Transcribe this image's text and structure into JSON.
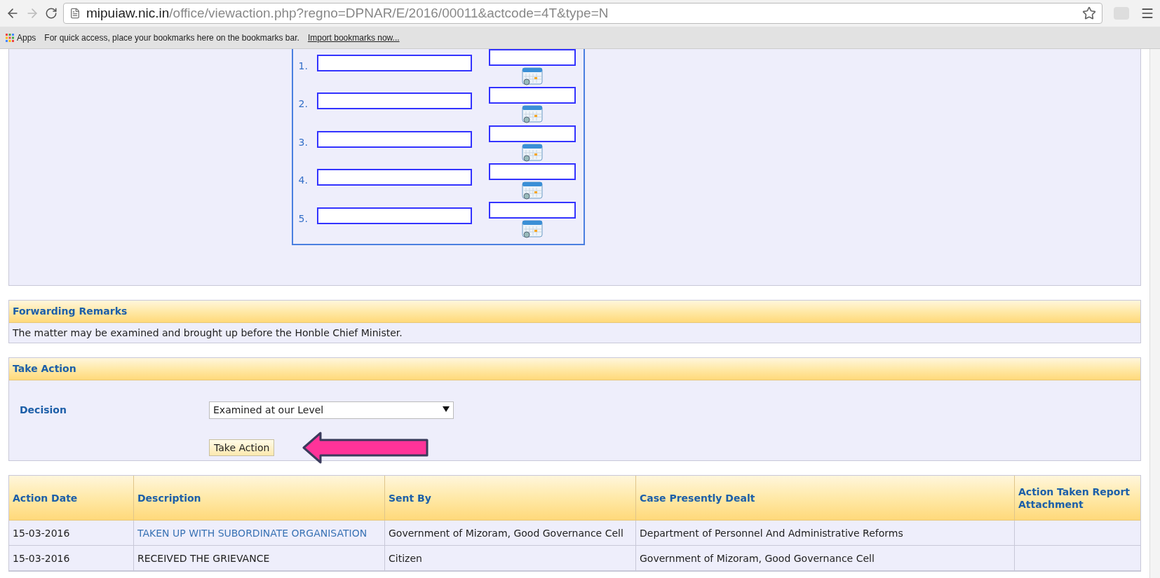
{
  "browser": {
    "url_host": "mipuiaw.nic.in",
    "url_path": "/office/viewaction.php?regno=DPNAR/E/2016/00011&actcode=4T&type=N",
    "bookmarks": {
      "apps": "Apps",
      "hint": "For quick access, place your bookmarks here on the bookmarks bar.",
      "import_link": "Import bookmarks now..."
    }
  },
  "entries": [
    {
      "number": "1."
    },
    {
      "number": "2."
    },
    {
      "number": "3."
    },
    {
      "number": "4."
    },
    {
      "number": "5."
    }
  ],
  "forwarding_remarks": {
    "title": "Forwarding Remarks",
    "text": "The matter may be examined and brought up before the Honble Chief Minister."
  },
  "take_action": {
    "title": "Take Action",
    "decision_label": "Decision",
    "decision_value": "Examined at our Level",
    "button": "Take Action"
  },
  "table": {
    "columns": [
      "Action Date",
      "Description",
      "Sent By",
      "Case Presently Dealt",
      "Action Taken Report Attachment"
    ],
    "rows": [
      {
        "cells": [
          "15-03-2016",
          "TAKEN UP WITH SUBORDINATE ORGANISATION",
          "Government of Mizoram, Good Governance Cell",
          "Department of Personnel And Administrative Reforms",
          ""
        ],
        "link": true
      },
      {
        "cells": [
          "15-03-2016",
          "RECEIVED THE GRIEVANCE",
          "Citizen",
          "Government of Mizoram, Good Governance Cell",
          ""
        ],
        "link": false
      }
    ]
  }
}
